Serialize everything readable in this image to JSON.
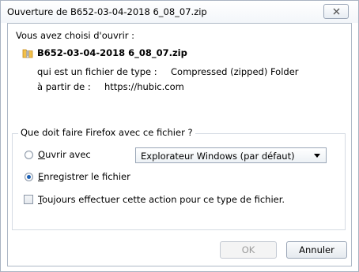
{
  "window": {
    "title": "Ouverture de B652-03-04-2018 6_08_07.zip"
  },
  "intro": {
    "label": "Vous avez choisi d'ouvrir :"
  },
  "file": {
    "name": "B652-03-04-2018 6_08_07.zip",
    "type_prefix": "qui est un fichier de type :",
    "type_value": "Compressed (zipped) Folder",
    "source_prefix": "à partir de :",
    "source_value": "https://hubic.com"
  },
  "action_group": {
    "legend": "Que doit faire Firefox avec ce fichier ?",
    "open_with": {
      "accel": "O",
      "rest": "uvrir avec",
      "selected": false
    },
    "app_select": {
      "value": "Explorateur Windows (par défaut)"
    },
    "save": {
      "accel": "E",
      "rest": "nregistrer le fichier",
      "selected": true
    },
    "always": {
      "accel": "T",
      "rest": "oujours effectuer cette action pour ce type de fichier.",
      "checked": false
    }
  },
  "buttons": {
    "ok": "OK",
    "cancel": "Annuler"
  },
  "icons": {
    "close": "close-icon",
    "file": "zip-file-icon",
    "dropdown": "chevron-down-icon"
  },
  "colors": {
    "accent": "#1a5fb4",
    "border": "#a9b3c2",
    "disabled_text": "#9b9b9b"
  }
}
